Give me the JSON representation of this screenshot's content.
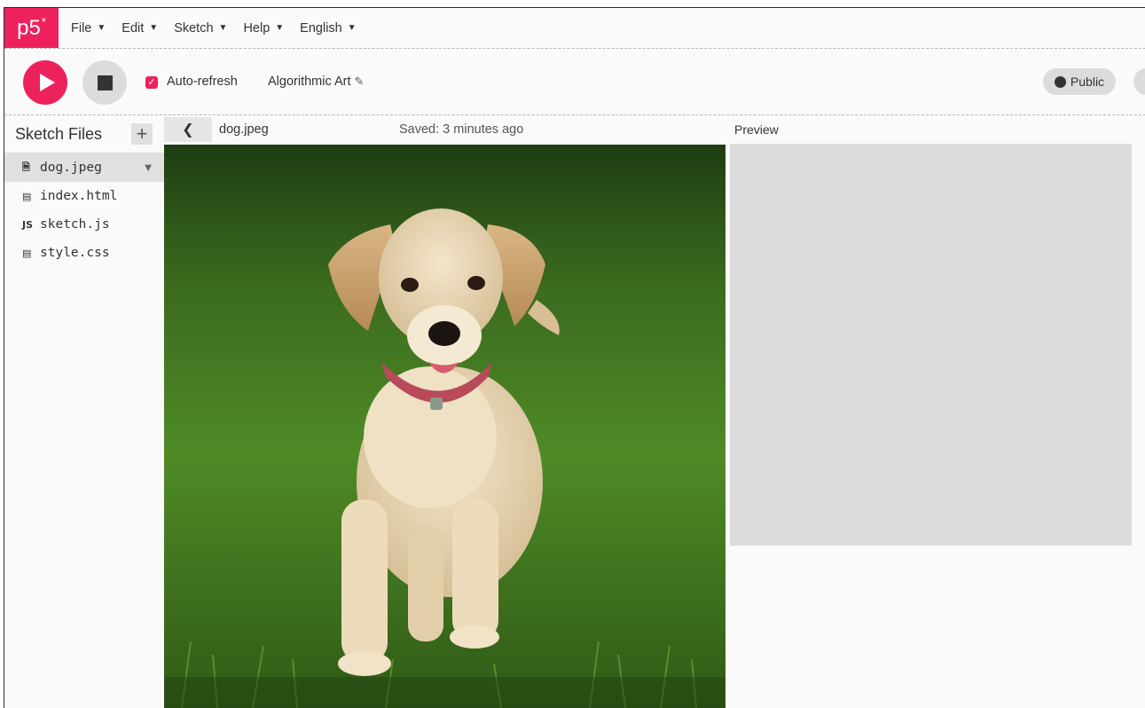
{
  "app": {
    "logo_text": "p5",
    "logo_sup": "*",
    "accent_color": "#ed225d"
  },
  "menu": {
    "items": [
      {
        "label": "File"
      },
      {
        "label": "Edit"
      },
      {
        "label": "Sketch"
      },
      {
        "label": "Help"
      },
      {
        "label": "English"
      }
    ]
  },
  "toolbar": {
    "play_icon": "play-icon",
    "stop_icon": "stop-icon",
    "auto_refresh_label": "Auto-refresh",
    "auto_refresh_checked": true,
    "sketch_name": "Algorithmic Art",
    "edit_icon": "pencil-icon",
    "visibility_label": "Public",
    "visibility_icon": "globe-icon"
  },
  "sidebar": {
    "title": "Sketch Files",
    "add_icon": "plus-icon",
    "files": [
      {
        "name": "dog.jpeg",
        "icon": "file-icon",
        "icon_glyph": "🗎",
        "selected": true
      },
      {
        "name": "index.html",
        "icon": "html-icon",
        "icon_glyph": "▤",
        "selected": false
      },
      {
        "name": "sketch.js",
        "icon": "js-icon",
        "icon_glyph": "JS",
        "selected": false
      },
      {
        "name": "style.css",
        "icon": "css-icon",
        "icon_glyph": "▤",
        "selected": false
      }
    ]
  },
  "editor": {
    "filename": "dog.jpeg",
    "saved_status": "Saved: 3 minutes ago",
    "image_subject": "labrador puppy walking on grass"
  },
  "preview": {
    "label": "Preview"
  }
}
